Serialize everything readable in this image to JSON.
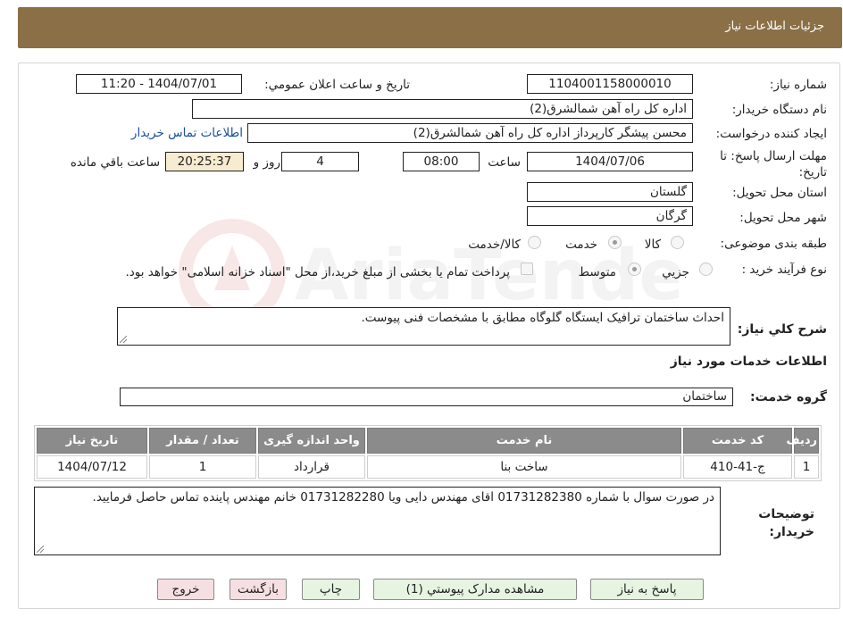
{
  "header": {
    "title": "جزئيات اطلاعات نياز"
  },
  "form": {
    "need_number_label": "شماره نياز:",
    "need_number": "1104001158000010",
    "announce_label": "تاريخ و ساعت اعلان عمومي:",
    "announce_value": "1404/07/01 - 11:20",
    "buyer_org_label": "نام دستگاه خريدار:",
    "buyer_org": "اداره کل راه آهن شمالشرق(2)",
    "requester_label": "ايجاد کننده درخواست:",
    "requester": "محسن پيشگر کارپرداز اداره کل راه آهن شمالشرق(2)",
    "contact_link": "اطلاعات تماس خريدار",
    "deadline_label": "مهلت ارسال پاسخ: تا تاريخ:",
    "deadline_date": "1404/07/06",
    "time_label": "ساعت",
    "deadline_time": "08:00",
    "days_value": "4",
    "days_label": "روز و",
    "remaining_time": "20:25:37",
    "remaining_label": "ساعت باقي مانده",
    "province_label": "استان محل تحويل:",
    "province": "گلستان",
    "city_label": "شهر محل تحويل:",
    "city": "گرگان",
    "category_label": "طبقه بندی موضوعی:",
    "category_options": [
      "کالا",
      "خدمت",
      "کالا/خدمت"
    ],
    "category_selected": "خدمت",
    "process_label": "نوع فرآيند خريد :",
    "process_options": [
      "جزيي",
      "متوسط"
    ],
    "process_selected": "متوسط",
    "payment_note": "پرداخت تمام يا بخشی از مبلغ خريد،از محل \"اسناد خزانه اسلامی\" خواهد بود."
  },
  "summary": {
    "label": "شرح کلي نياز:",
    "text": "احداث ساختمان ترافيک ايستگاه گلوگاه مطابق با مشخصات فنی پيوست."
  },
  "services": {
    "title": "اطلاعات خدمات مورد نياز",
    "group_label": "گروه خدمت:",
    "group_value": "ساختمان",
    "columns": [
      "رديف",
      "کد خدمت",
      "نام خدمت",
      "واحد اندازه گيری",
      "تعداد / مقدار",
      "تاريخ نياز"
    ],
    "rows": [
      [
        "1",
        "ج-41-410",
        "ساخت بنا",
        "قرارداد",
        "1",
        "1404/07/12"
      ]
    ]
  },
  "buyer_notes": {
    "label": "توضيحات خريدار:",
    "text": "در صورت سوال با شماره 01731282380 اقای مهندس دايی ويا  01731282280 خانم مهندس پاينده تماس حاصل فرماييد."
  },
  "buttons": {
    "reply": "پاسخ به نياز",
    "attachments": "مشاهده مدارک پيوستي (1)",
    "print": "چاپ",
    "back": "بازگشت",
    "exit": "خروج"
  },
  "watermark_text": "AriaTender.neT",
  "colors": {
    "header": "#8b6f47",
    "link": "#1a4fa3",
    "table_header": "#8b8b8b",
    "green_button": "#e6f4e1",
    "pink_button": "#f6dfe2",
    "timer": "#f7eccf"
  }
}
